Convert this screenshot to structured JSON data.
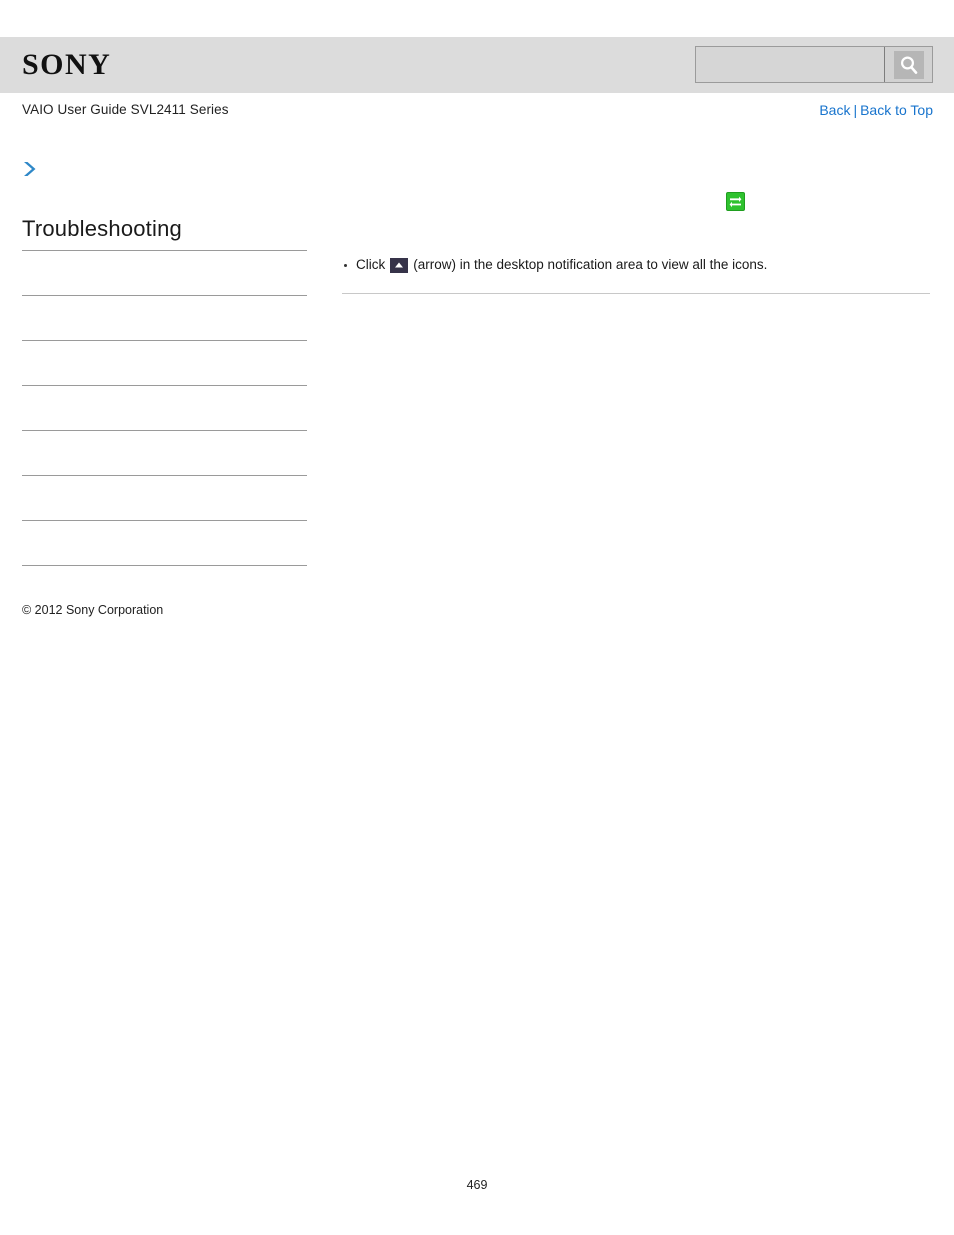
{
  "header": {
    "logo_text": "SONY",
    "logo_bg": "#dcdcdc"
  },
  "search": {
    "value": "",
    "placeholder": "",
    "icon": "search-icon",
    "button_label": ""
  },
  "document": {
    "title": "VAIO User Guide SVL2411 Series"
  },
  "nav": {
    "back_label": "Back",
    "separator": "|",
    "back_to_top_label": "Back to Top",
    "link_color": "#1874CD"
  },
  "sidebar": {
    "breadcrumb_icon": "chevron-right-icon",
    "heading": "Troubleshooting",
    "items": [
      {
        "label": ""
      },
      {
        "label": ""
      },
      {
        "label": ""
      },
      {
        "label": ""
      },
      {
        "label": ""
      },
      {
        "label": ""
      },
      {
        "label": ""
      }
    ],
    "copyright": "© 2012 Sony Corporation"
  },
  "content": {
    "status_icon": "green-sync-icon",
    "status_icon_color": "#2fc22f",
    "bullets": [
      {
        "text_before": "Click",
        "icon": "up-arrow-icon",
        "text_after": "(arrow) in the desktop notification area to view all the icons."
      }
    ]
  },
  "footer": {
    "page_number": "469"
  }
}
